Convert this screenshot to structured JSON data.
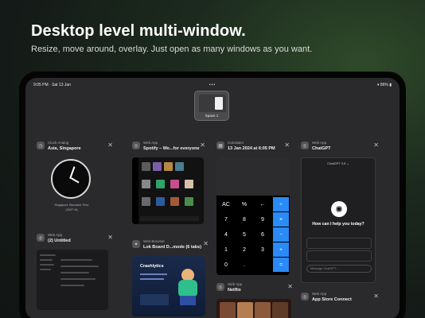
{
  "headline": "Desktop level multi-window.",
  "subhead": "Resize, move around, overlay. Just open as many windows as you want.",
  "status": {
    "time_date": "9:05 PM · Sat 13 Jan",
    "dots": "•••",
    "battery": "▾ 86% ▮"
  },
  "space": {
    "label": "Space 1"
  },
  "windows": {
    "clock": {
      "kind": "Clock Analog",
      "title": "Asia, Singapore",
      "caption1": "Singapore Standard Time",
      "caption2": "(GMT+8)"
    },
    "spotify": {
      "kind": "Web App",
      "title": "Spotify – We...for everyone"
    },
    "calculator": {
      "kind": "Calculator",
      "title": "13 Jan 2024 at 6:05 PM",
      "keys": [
        [
          "AC",
          "%",
          "←",
          "÷"
        ],
        [
          "7",
          "8",
          "9",
          "×"
        ],
        [
          "4",
          "5",
          "6",
          "−"
        ],
        [
          "1",
          "2",
          "3",
          "+"
        ],
        [
          "0",
          ".",
          "="
        ]
      ]
    },
    "chatgpt": {
      "kind": "Web App",
      "title": "ChatGPT",
      "bar": "ChatGPT 3.5 ⌄",
      "question": "How can I help you today?",
      "input": "Message ChatGPT…"
    },
    "untitled": {
      "kind": "Web App",
      "title": "(2) Untitled"
    },
    "browser": {
      "kind": "Web Browser",
      "title": "Lok Board D...mode (6 tabs)",
      "heading": "Crashlytics"
    },
    "netflix": {
      "kind": "Web App",
      "title": "Netflix"
    },
    "appstore": {
      "kind": "Web App",
      "title": "App Store Connect"
    }
  },
  "colors": {
    "accent_blue": "#2a8af6",
    "calc_op": "#2a8af6"
  },
  "icons": {
    "close": "✕"
  }
}
